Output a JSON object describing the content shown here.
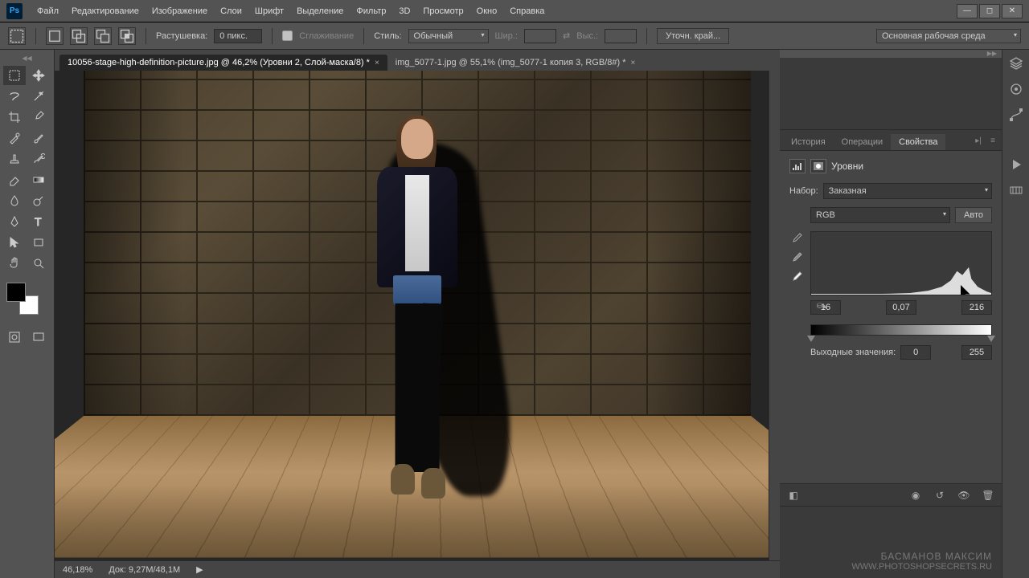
{
  "menu": [
    "Файл",
    "Редактирование",
    "Изображение",
    "Слои",
    "Шрифт",
    "Выделение",
    "Фильтр",
    "3D",
    "Просмотр",
    "Окно",
    "Справка"
  ],
  "options": {
    "feather_label": "Растушевка:",
    "feather_value": "0 пикс.",
    "antialias": "Сглаживание",
    "style_label": "Стиль:",
    "style_value": "Обычный",
    "width_label": "Шир.:",
    "height_label": "Выс.:",
    "refine": "Уточн. край...",
    "workspace": "Основная рабочая среда"
  },
  "tabs": {
    "active": "10056-stage-high-definition-picture.jpg @ 46,2% (Уровни 2, Слой-маска/8) *",
    "inactive": "img_5077-1.jpg @ 55,1% (img_5077-1 копия 3, RGB/8#) *"
  },
  "status": {
    "zoom": "46,18%",
    "doc": "Док: 9,27М/48,1М"
  },
  "panels": {
    "tabs": [
      "История",
      "Операции",
      "Свойства"
    ],
    "properties": {
      "title": "Уровни",
      "preset_label": "Набор:",
      "preset_value": "Заказная",
      "channel": "RGB",
      "auto": "Авто",
      "input_shadow": "16",
      "input_gamma": "0,07",
      "input_highlight": "216",
      "output_label": "Выходные значения:",
      "output_low": "0",
      "output_high": "255"
    }
  },
  "watermark": {
    "name": "БАСМАНОВ МАКСИМ",
    "url": "WWW.PHOTOSHOPSECRETS.RU"
  }
}
